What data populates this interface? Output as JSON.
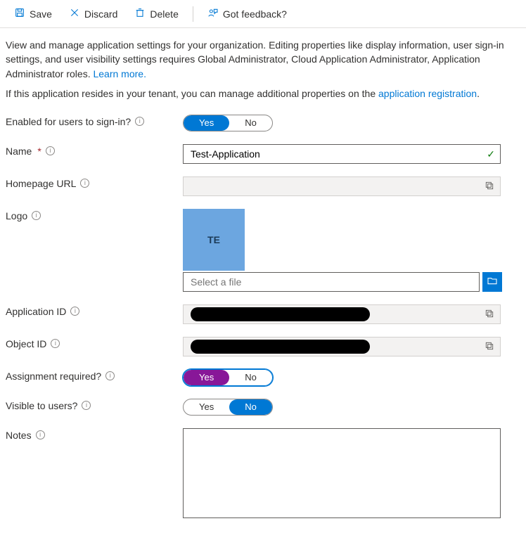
{
  "toolbar": {
    "save": "Save",
    "discard": "Discard",
    "delete": "Delete",
    "feedback": "Got feedback?"
  },
  "intro": {
    "main": "View and manage application settings for your organization. Editing properties like display information, user sign-in settings, and user visibility settings requires Global Administrator, Cloud Application Administrator, Application Administrator roles. ",
    "learn_more": "Learn more.",
    "tenant_prefix": "If this application resides in your tenant, you can manage additional properties on the ",
    "tenant_link": "application registration",
    "tenant_suffix": "."
  },
  "labels": {
    "enabled": "Enabled for users to sign-in?",
    "name": "Name",
    "homepage": "Homepage URL",
    "logo": "Logo",
    "app_id": "Application ID",
    "object_id": "Object ID",
    "assignment": "Assignment required?",
    "visible": "Visible to users?",
    "notes": "Notes"
  },
  "toggles": {
    "yes": "Yes",
    "no": "No"
  },
  "fields": {
    "name_value": "Test-Application",
    "homepage_value": "",
    "logo_text": "TE",
    "file_placeholder": "Select a file",
    "app_id_value": "",
    "object_id_value": "",
    "notes_value": ""
  }
}
